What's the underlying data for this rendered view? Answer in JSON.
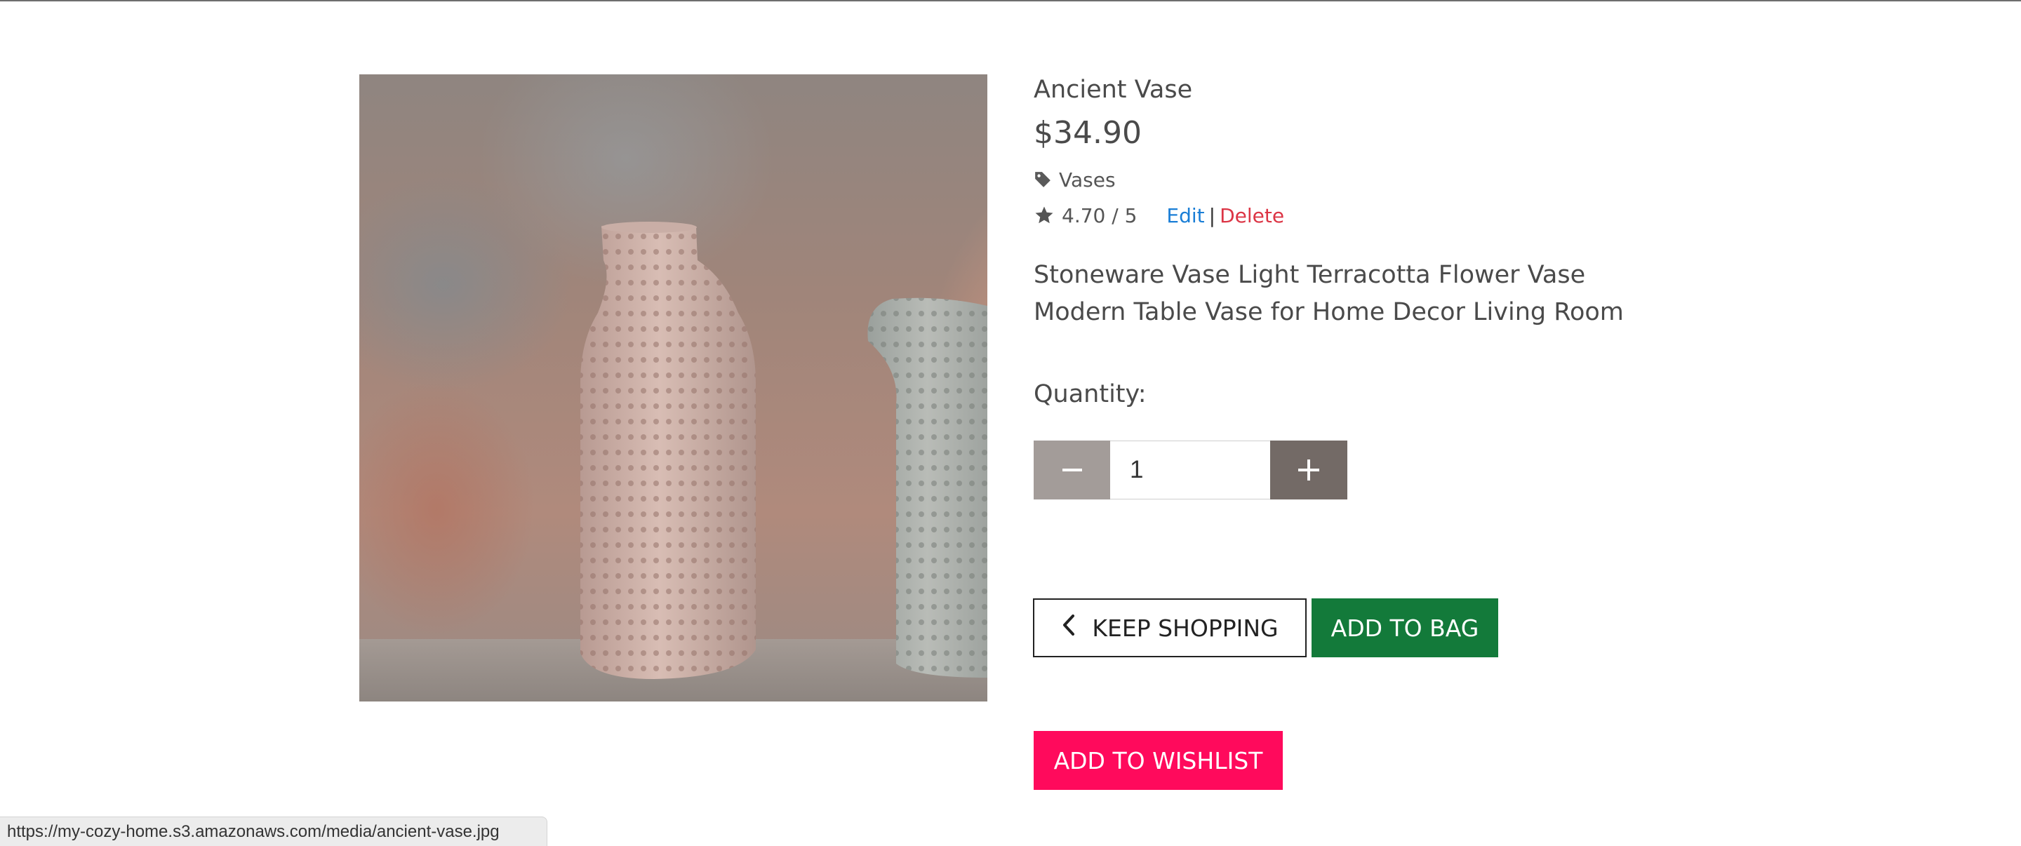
{
  "product": {
    "title": "Ancient Vase",
    "price": "$34.90",
    "category": "Vases",
    "category_icon": "tag-icon",
    "rating": "4.70 / 5",
    "rating_icon": "star-icon",
    "edit_label": "Edit",
    "separator": "|",
    "delete_label": "Delete",
    "description": "Stoneware Vase Light Terracotta Flower Vase Modern Table Vase for Home Decor Living Room",
    "image_alt": "Ancient Vase"
  },
  "quantity": {
    "label": "Quantity:",
    "value": "1",
    "minus_icon": "minus-icon",
    "plus_icon": "plus-icon"
  },
  "actions": {
    "keep_shopping": "KEEP SHOPPING",
    "keep_shopping_icon": "chevron-left-icon",
    "add_to_bag": "ADD TO BAG",
    "add_to_wishlist": "ADD TO WISHLIST"
  },
  "status_bar": {
    "url": "https://my-cozy-home.s3.amazonaws.com/media/ancient-vase.jpg"
  },
  "colors": {
    "add_to_bag": "#137a3a",
    "wishlist": "#ff0a5c",
    "edit_link": "#1a7ed6",
    "delete_link": "#dc3545",
    "qty_minus": "#a39c99",
    "qty_plus": "#736a66"
  }
}
